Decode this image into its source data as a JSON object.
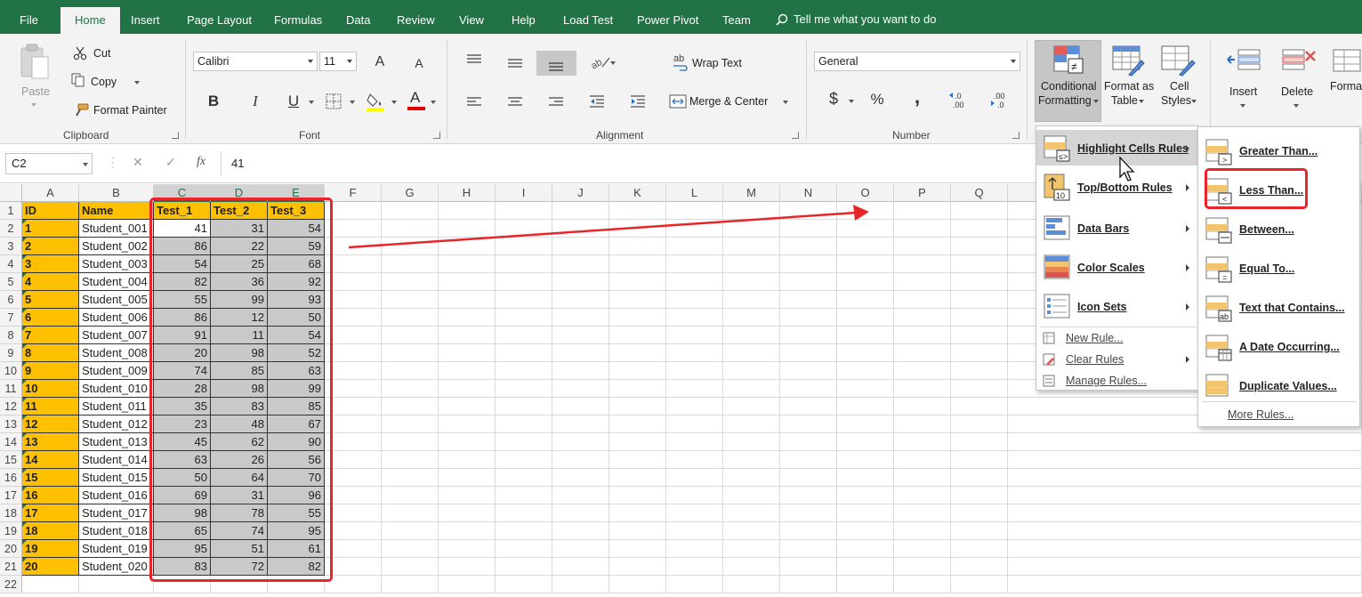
{
  "tabs": [
    "File",
    "Home",
    "Insert",
    "Page Layout",
    "Formulas",
    "Data",
    "Review",
    "View",
    "Help",
    "Load Test",
    "Power Pivot",
    "Team"
  ],
  "active_tab": "Home",
  "tell_me": "Tell me what you want to do",
  "ribbon": {
    "clipboard": {
      "paste": "Paste",
      "cut": "Cut",
      "copy": "Copy",
      "format_painter": "Format Painter",
      "group": "Clipboard"
    },
    "font": {
      "name": "Calibri",
      "size": "11",
      "bold": "B",
      "italic": "I",
      "underline": "U",
      "grow": "A",
      "shrink": "A",
      "group": "Font",
      "font_color_label": "A"
    },
    "alignment": {
      "wrap_text": "Wrap Text",
      "merge_center": "Merge & Center",
      "group": "Alignment",
      "wrap_icon_text": "ab"
    },
    "number": {
      "format": "General",
      "currency": "$",
      "percent": "%",
      "comma": ",",
      "inc_decimal": ".0\n.00",
      "dec_decimal": ".00\n.0",
      "group": "Number"
    },
    "styles": {
      "conditional_formatting_1": "Conditional",
      "conditional_formatting_2": "Formatting",
      "format_as_table_1": "Format as",
      "format_as_table_2": "Table",
      "cell_styles_1": "Cell",
      "cell_styles_2": "Styles"
    },
    "cells": {
      "insert": "Insert",
      "delete": "Delete",
      "format": "Format"
    }
  },
  "formula_bar": {
    "name_box": "C2",
    "value": "41",
    "fx": "fx"
  },
  "columns": [
    "A",
    "B",
    "C",
    "D",
    "E",
    "F",
    "G",
    "H",
    "I",
    "J",
    "K",
    "L",
    "M",
    "N",
    "O",
    "P",
    "Q"
  ],
  "selected_columns": [
    "C",
    "D",
    "E"
  ],
  "sheet": {
    "headers": [
      "ID",
      "Name",
      "Test_1",
      "Test_2",
      "Test_3"
    ],
    "rows": [
      [
        "1",
        "Student_001",
        "41",
        "31",
        "54"
      ],
      [
        "2",
        "Student_002",
        "86",
        "22",
        "59"
      ],
      [
        "3",
        "Student_003",
        "54",
        "25",
        "68"
      ],
      [
        "4",
        "Student_004",
        "82",
        "36",
        "92"
      ],
      [
        "5",
        "Student_005",
        "55",
        "99",
        "93"
      ],
      [
        "6",
        "Student_006",
        "86",
        "12",
        "50"
      ],
      [
        "7",
        "Student_007",
        "91",
        "11",
        "54"
      ],
      [
        "8",
        "Student_008",
        "20",
        "98",
        "52"
      ],
      [
        "9",
        "Student_009",
        "74",
        "85",
        "63"
      ],
      [
        "10",
        "Student_010",
        "28",
        "98",
        "99"
      ],
      [
        "11",
        "Student_011",
        "35",
        "83",
        "85"
      ],
      [
        "12",
        "Student_012",
        "23",
        "48",
        "67"
      ],
      [
        "13",
        "Student_013",
        "45",
        "62",
        "90"
      ],
      [
        "14",
        "Student_014",
        "63",
        "26",
        "56"
      ],
      [
        "15",
        "Student_015",
        "50",
        "64",
        "70"
      ],
      [
        "16",
        "Student_016",
        "69",
        "31",
        "96"
      ],
      [
        "17",
        "Student_017",
        "98",
        "78",
        "55"
      ],
      [
        "18",
        "Student_018",
        "65",
        "74",
        "95"
      ],
      [
        "19",
        "Student_019",
        "95",
        "51",
        "61"
      ],
      [
        "20",
        "Student_020",
        "83",
        "72",
        "82"
      ]
    ]
  },
  "cf_menu": {
    "items": [
      "Highlight Cells Rules",
      "Top/Bottom Rules",
      "Data Bars",
      "Color Scales",
      "Icon Sets"
    ],
    "small_items": [
      "New Rule...",
      "Clear Rules",
      "Manage Rules..."
    ],
    "highlighted": "Highlight Cells Rules"
  },
  "hc_menu": {
    "items": [
      "Greater Than...",
      "Less Than...",
      "Between...",
      "Equal To...",
      "Text that Contains...",
      "A Date Occurring...",
      "Duplicate Values..."
    ],
    "more": "More Rules...",
    "annotated": "Less Than..."
  },
  "colors": {
    "excel_green": "#217346",
    "header_fill": "#ffc000",
    "selection_fill": "#c9c9c9",
    "annotation_red": "#e8262a"
  }
}
